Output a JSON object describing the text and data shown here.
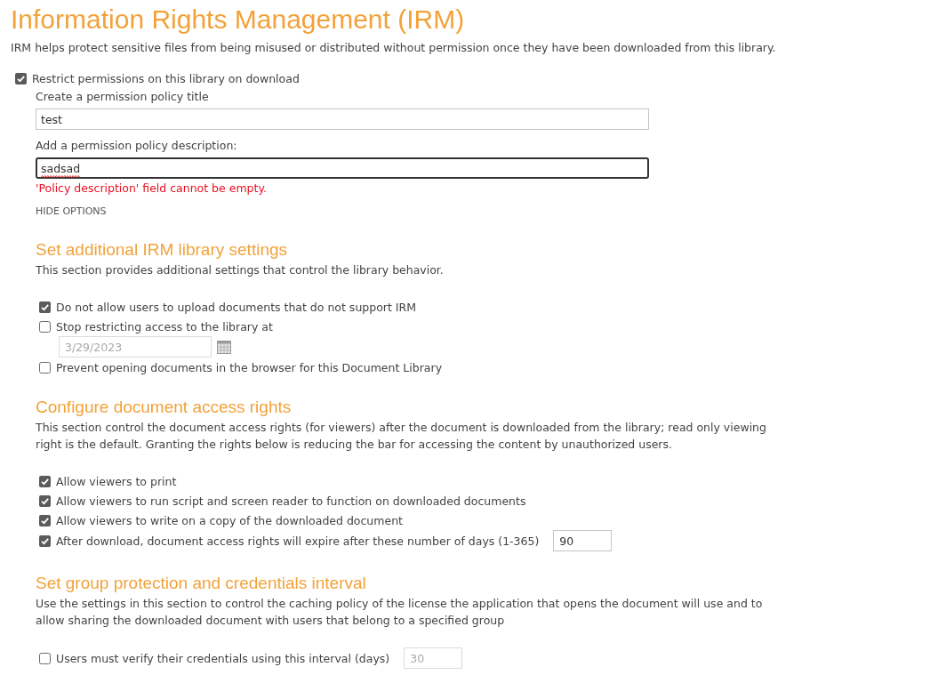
{
  "page": {
    "title": "Information Rights Management (IRM)",
    "description": "IRM helps protect sensitive files from being misused or distributed without permission once they have been downloaded from this library."
  },
  "restrict_permissions": {
    "label": "Restrict permissions on this library on download",
    "checked": true
  },
  "policy": {
    "title_field": {
      "label": "Create a permission policy title",
      "value": "test",
      "focused": false
    },
    "description_field": {
      "label": "Add a permission policy description:",
      "value": "sadsad",
      "focused": true,
      "spelling_error": true,
      "error": "'Policy description' field cannot be empty."
    },
    "options_link": "HIDE OPTIONS"
  },
  "sections": [
    {
      "heading": "Set additional IRM library settings",
      "description": "This section provides additional settings that control the library behavior.",
      "options": [
        {
          "label": "Do not allow users to upload documents that do not support IRM",
          "checked": true
        },
        {
          "label": "Stop restricting access to the library at",
          "checked": false,
          "field": {
            "kind": "date",
            "value": "3/29/2023",
            "disabled": true
          }
        },
        {
          "label": "Prevent opening documents in the browser for this Document Library",
          "checked": false
        }
      ]
    },
    {
      "heading": "Configure document access rights",
      "description": "This section control the document access rights (for viewers) after the document is downloaded from the library; read only viewing right is the default. Granting the rights below is reducing the bar for accessing the content by unauthorized users.",
      "options": [
        {
          "label": "Allow viewers to print",
          "checked": true
        },
        {
          "label": "Allow viewers to run script and screen reader to function on downloaded documents",
          "checked": true
        },
        {
          "label": "Allow viewers to write on a copy of the downloaded document",
          "checked": true
        },
        {
          "label": "After download, document access rights will expire after these number of days (1-365)",
          "checked": true,
          "field": {
            "kind": "number",
            "value": "90",
            "disabled": false
          }
        }
      ]
    },
    {
      "heading": "Set group protection and credentials interval",
      "description": "Use the settings in this section to control the caching policy of the license the application that opens the document will use and to allow sharing the downloaded document with users that belong to a specified group",
      "options": [
        {
          "label": "Users must verify their credentials using this interval (days)",
          "checked": false,
          "field": {
            "kind": "number",
            "value": "30",
            "disabled": true
          }
        }
      ]
    }
  ]
}
